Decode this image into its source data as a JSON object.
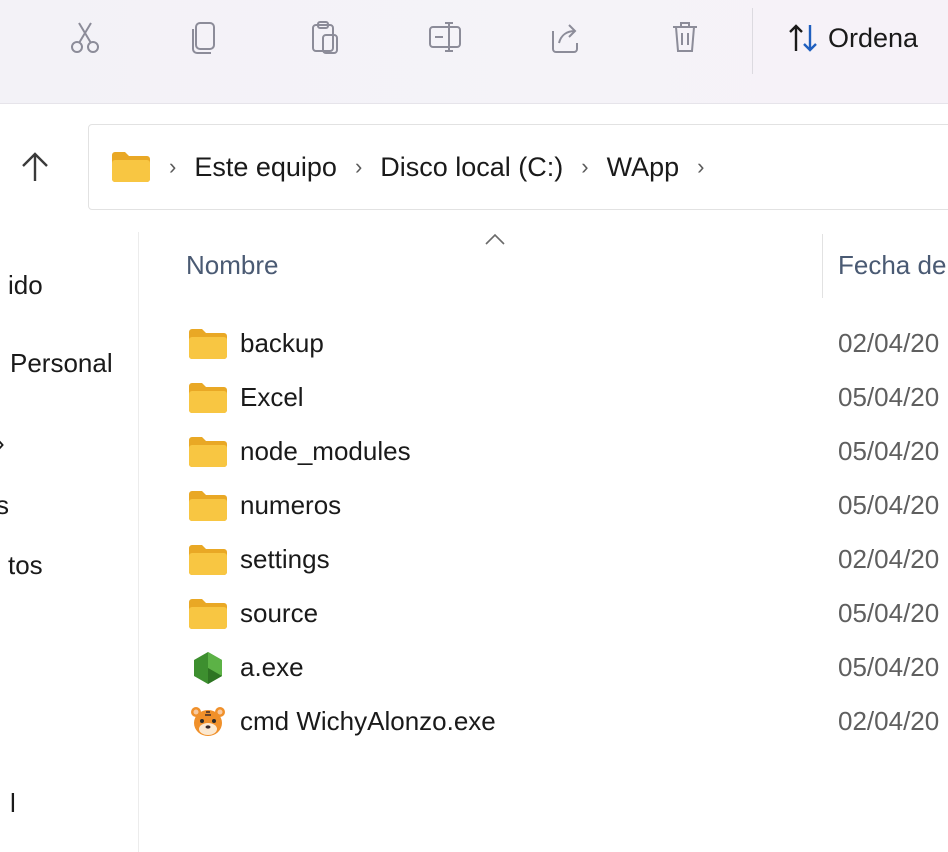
{
  "toolbar": {
    "sort_label": "Ordena",
    "colors": {
      "icon_gray": "#8c8c99",
      "arrow_blue": "#1f5fbf"
    }
  },
  "breadcrumb": {
    "items": [
      "Este equipo",
      "Disco local (C:)",
      "WApp"
    ],
    "chevron": "›"
  },
  "nav_pane": {
    "items": [
      "ido",
      "Personal",
      "›",
      "s",
      "tos",
      "l"
    ]
  },
  "columns": {
    "name": "Nombre",
    "date": "Fecha de"
  },
  "files": [
    {
      "name": "backup",
      "date": "02/04/20",
      "icon": "folder-icon"
    },
    {
      "name": "Excel",
      "date": "05/04/20",
      "icon": "folder-icon"
    },
    {
      "name": "node_modules",
      "date": "05/04/20",
      "icon": "folder-icon"
    },
    {
      "name": "numeros",
      "date": "05/04/20",
      "icon": "folder-icon"
    },
    {
      "name": "settings",
      "date": "02/04/20",
      "icon": "folder-icon"
    },
    {
      "name": "source",
      "date": "05/04/20",
      "icon": "folder-icon"
    },
    {
      "name": "a.exe",
      "date": "05/04/20",
      "icon": "nodejs-hexagon-icon"
    },
    {
      "name": "cmd WichyAlonzo.exe",
      "date": "02/04/20",
      "icon": "tiger-face-icon"
    }
  ],
  "colors": {
    "folder_yellow": "#f8c642",
    "folder_back": "#e9a825",
    "header_text": "#4a5a73",
    "date_text": "#5f5f5f"
  }
}
